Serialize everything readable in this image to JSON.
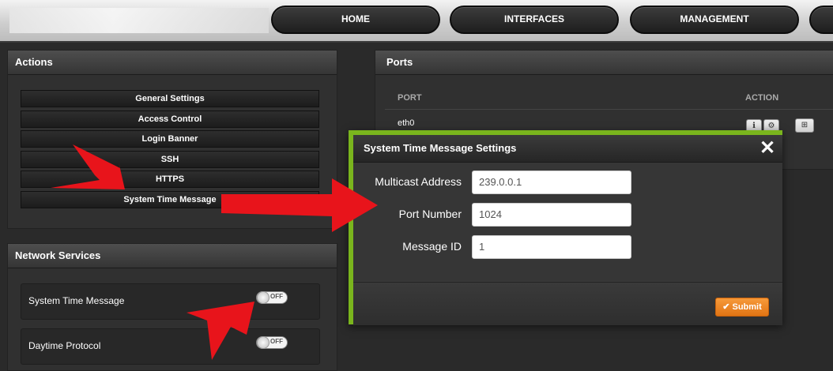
{
  "nav": {
    "items": [
      {
        "label": "HOME"
      },
      {
        "label": "INTERFACES"
      },
      {
        "label": "MANAGEMENT"
      }
    ]
  },
  "actions_panel": {
    "title": "Actions",
    "buttons": [
      {
        "label": "General Settings"
      },
      {
        "label": "Access Control"
      },
      {
        "label": "Login Banner"
      },
      {
        "label": "SSH"
      },
      {
        "label": "HTTPS"
      },
      {
        "label": "System Time Message"
      }
    ]
  },
  "network_services": {
    "title": "Network Services",
    "items": [
      {
        "label": "System Time Message",
        "toggle": "OFF"
      },
      {
        "label": "Daytime Protocol",
        "toggle": "OFF"
      }
    ]
  },
  "ports_panel": {
    "title": "Ports",
    "columns": {
      "port": "PORT",
      "action": "ACTION"
    },
    "rows": [
      {
        "port": "eth0"
      }
    ],
    "action_icons": [
      "info-icon",
      "gear-icon",
      "grid-icon"
    ]
  },
  "modal": {
    "title": "System Time Message Settings",
    "close_glyph": "✕",
    "fields": [
      {
        "label": "Multicast Address",
        "value": "239.0.0.1"
      },
      {
        "label": "Port Number",
        "value": "1024"
      },
      {
        "label": "Message ID",
        "value": "1"
      }
    ],
    "submit_label": "Submit",
    "submit_icon": "check-icon"
  },
  "colors": {
    "modal_border": "#7ab51d",
    "submit": "#ef8a22",
    "annotation_arrow": "#e8141b"
  }
}
